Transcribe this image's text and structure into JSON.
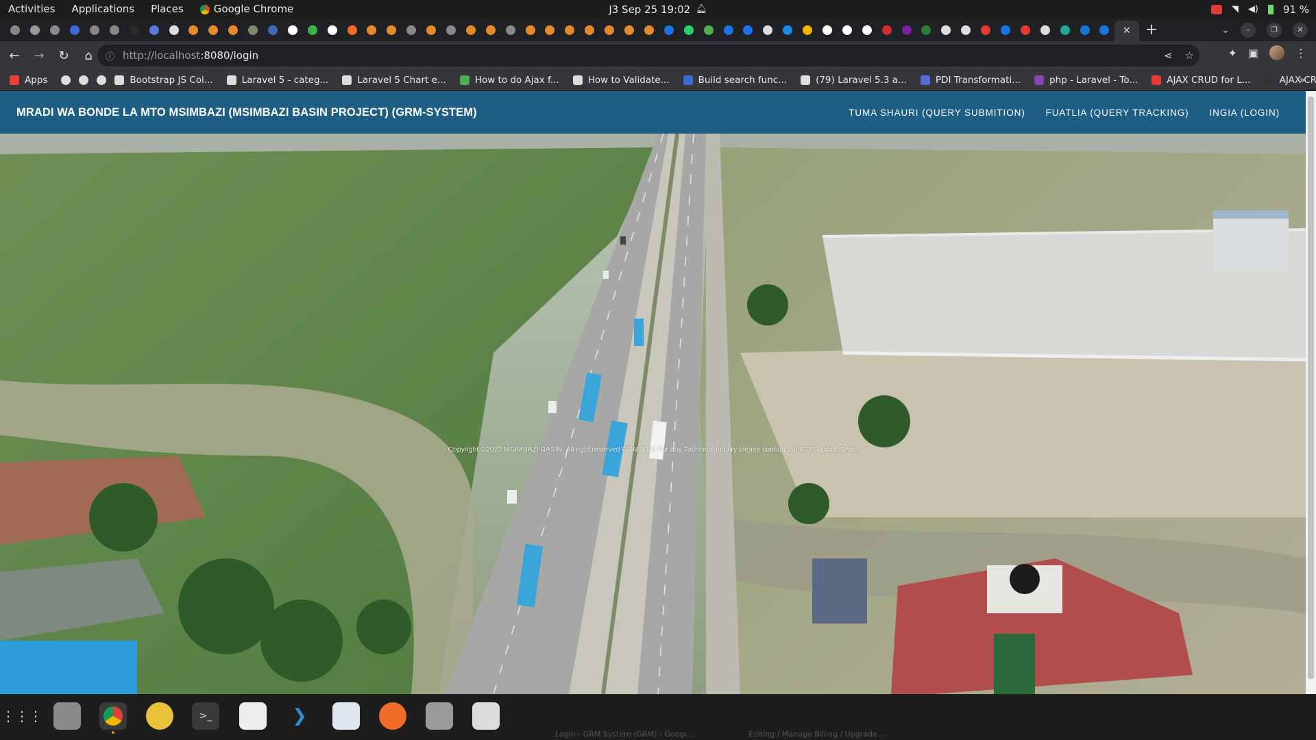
{
  "topbar": {
    "activities": "Activities",
    "applications": "Applications",
    "places": "Places",
    "app_name": "Google Chrome",
    "datetime": "J3 Sep 25  19:02",
    "battery": "91 %"
  },
  "browser": {
    "url_host": "http://localhost",
    "url_path": ":8080/login",
    "bookmarks": [
      "Apps",
      "Bootstrap JS Col...",
      "Laravel 5 - categ...",
      "Laravel 5 Chart e...",
      "How to do Ajax f...",
      "How to Validate...",
      "Build search func...",
      "(79) Laravel 5.3 a...",
      "PDI Transformati...",
      "php - Laravel - To...",
      "AJAX CRUD for L...",
      "AJAX CRUD Demo"
    ],
    "bookmarks_overflow": "»"
  },
  "app": {
    "brand": "MRADI WA BONDE LA MTO MSIMBAZI (MSIMBAZI BASIN PROJECT) (GRM-SYSTEM)",
    "nav": [
      "TUMA SHAURI (QUERY SUBMITION)",
      "FUATLIA (QUERY TRACKING)",
      "INGIA (LOGIN)"
    ],
    "copyright": "Copyright ©2022 MSIMBAZI BASIN. All right reserved GRM V1.0  For any Technical inquiry please contact our ICT Support Team"
  },
  "taskbar": {
    "window_labels": [
      "Login - GRM System (GRM) - Googl...",
      "Editing / Manage Billing / Upgrade ..."
    ]
  },
  "colors": {
    "nav_bar": "#1e5e84",
    "chrome_dark": "#202124",
    "chrome_toolbar": "#35363a"
  }
}
